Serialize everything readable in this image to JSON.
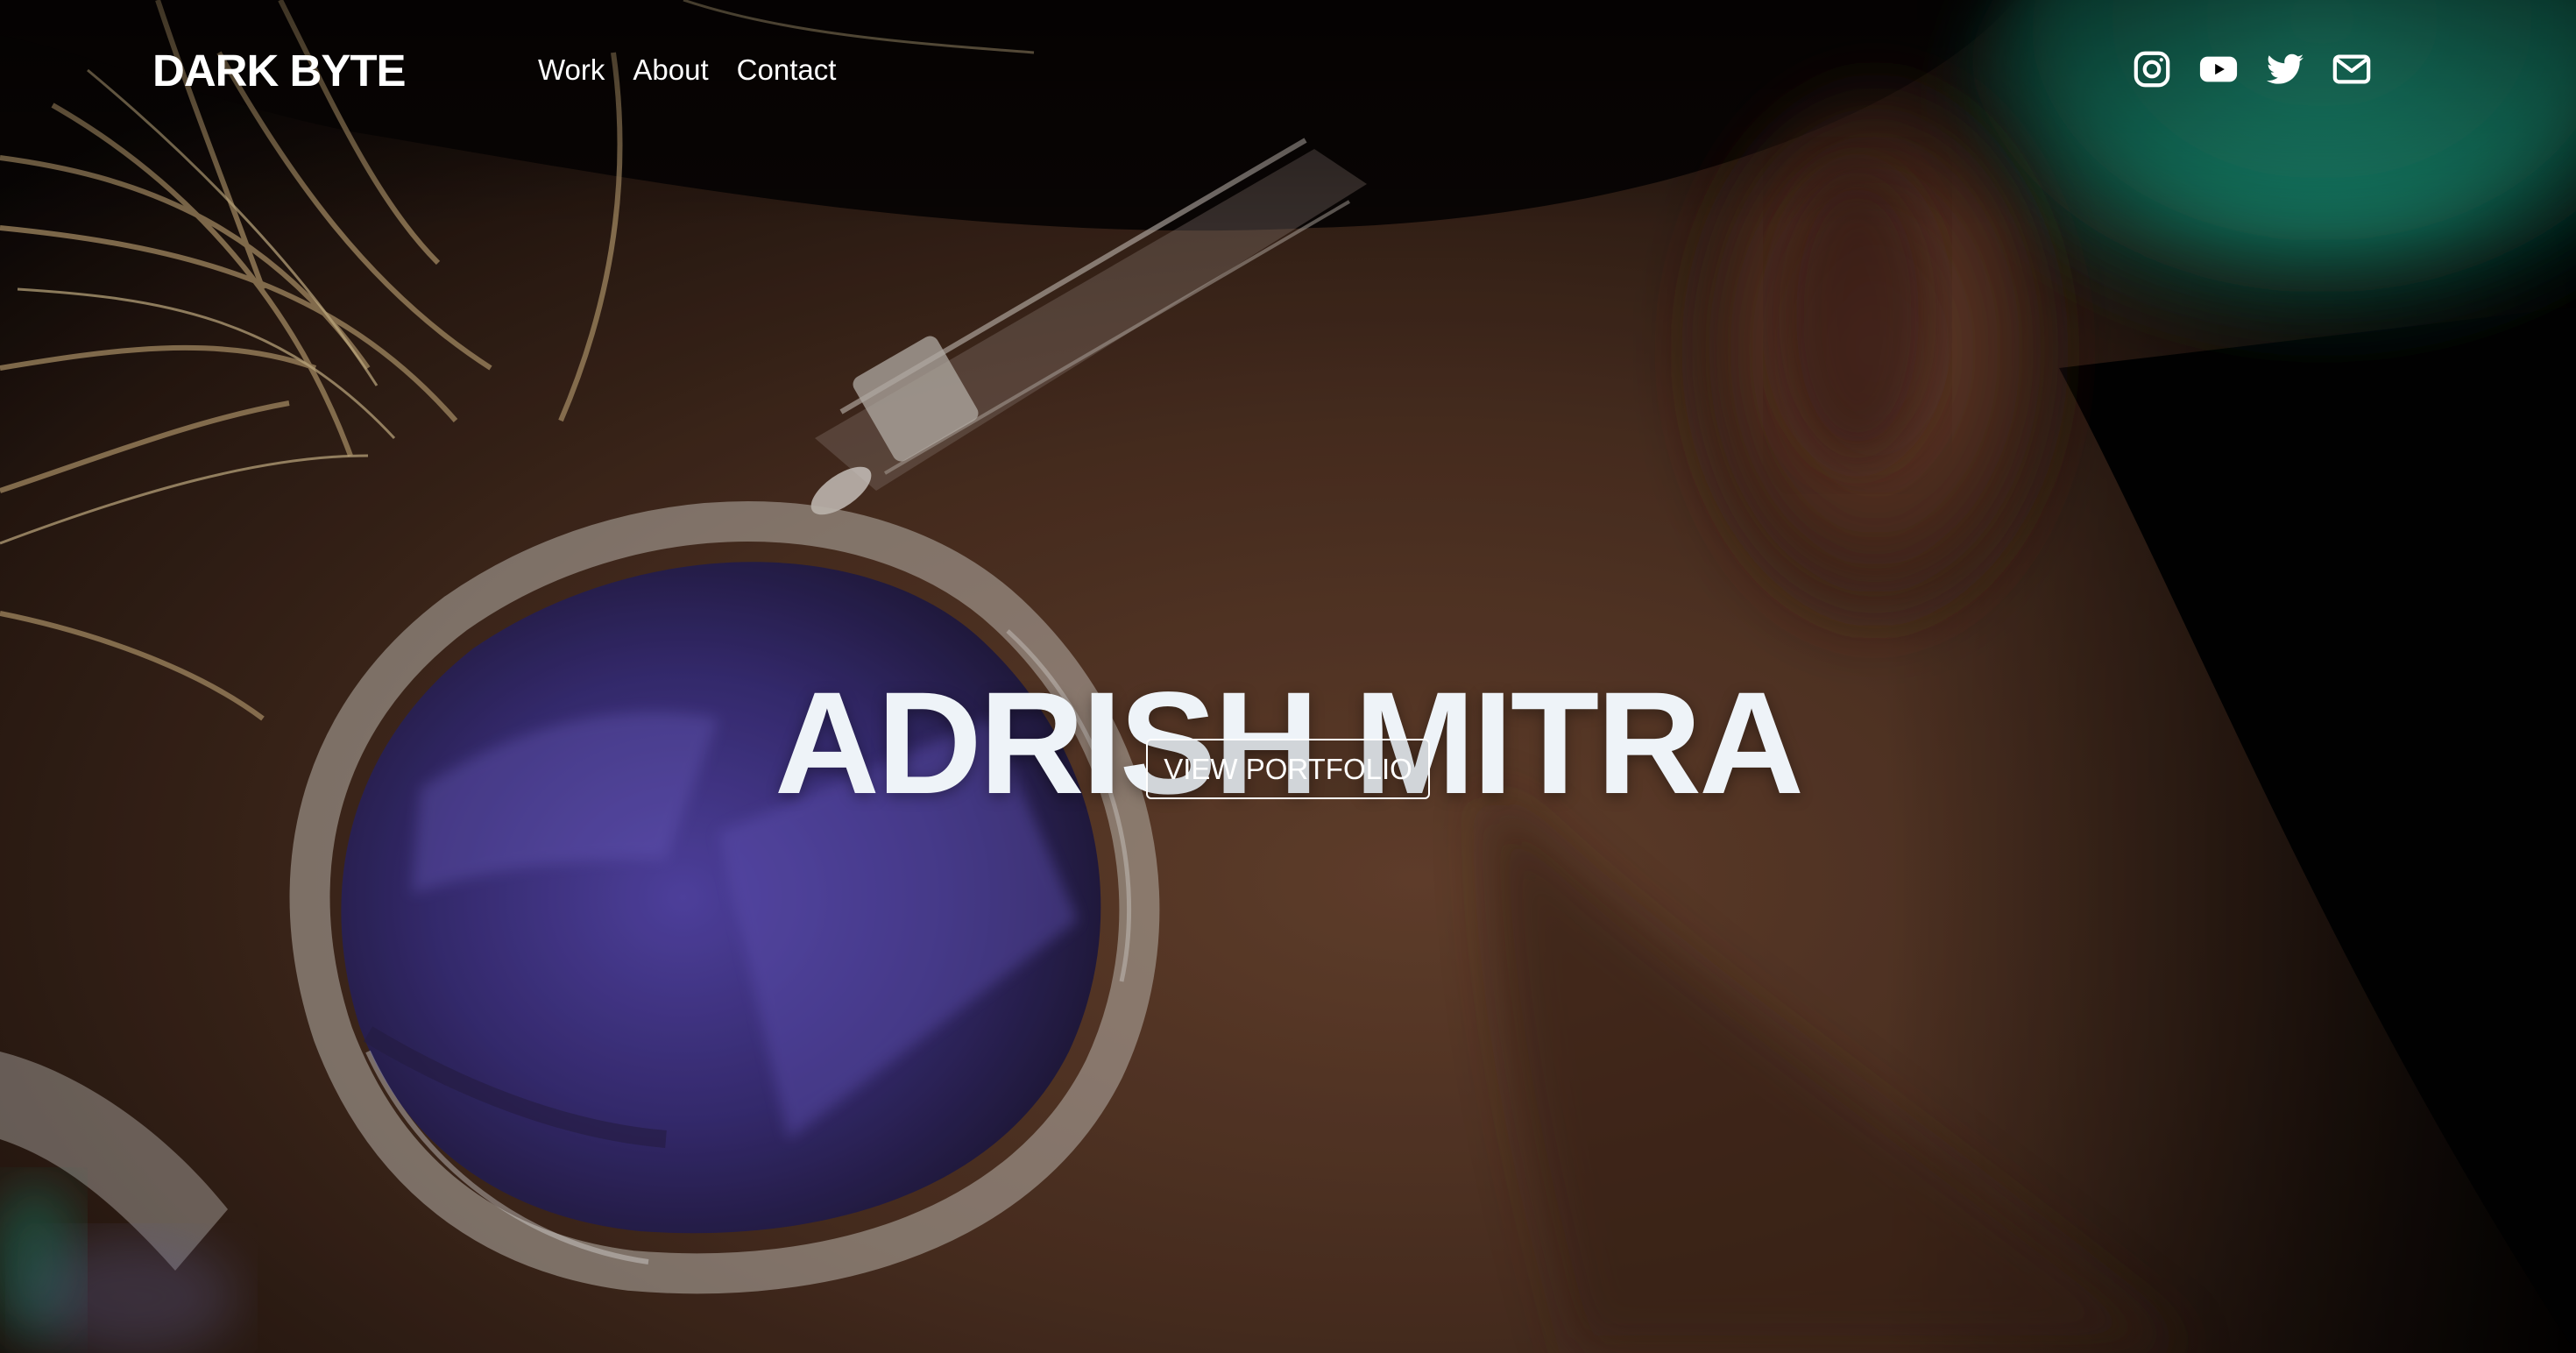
{
  "brand": {
    "name": "DARK BYTE"
  },
  "nav": {
    "links": [
      {
        "label": "Work"
      },
      {
        "label": "About"
      },
      {
        "label": "Contact"
      }
    ]
  },
  "social": {
    "icons": [
      "instagram-icon",
      "youtube-icon",
      "twitter-icon",
      "mail-icon"
    ]
  },
  "hero": {
    "title": "ADRISH MITRA",
    "cta_label": "VIEW PORTFOLIO",
    "background": "video still: close-up of a person wearing clear-framed glasses with purple lenses, blonde hair, teal light on the right"
  },
  "colors": {
    "text": "#ffffff",
    "title": "#eef3f8",
    "lens_purple": "#4a3e9c",
    "skin": "#5a3a26",
    "teal": "#1f9e82",
    "dark": "#000000"
  }
}
